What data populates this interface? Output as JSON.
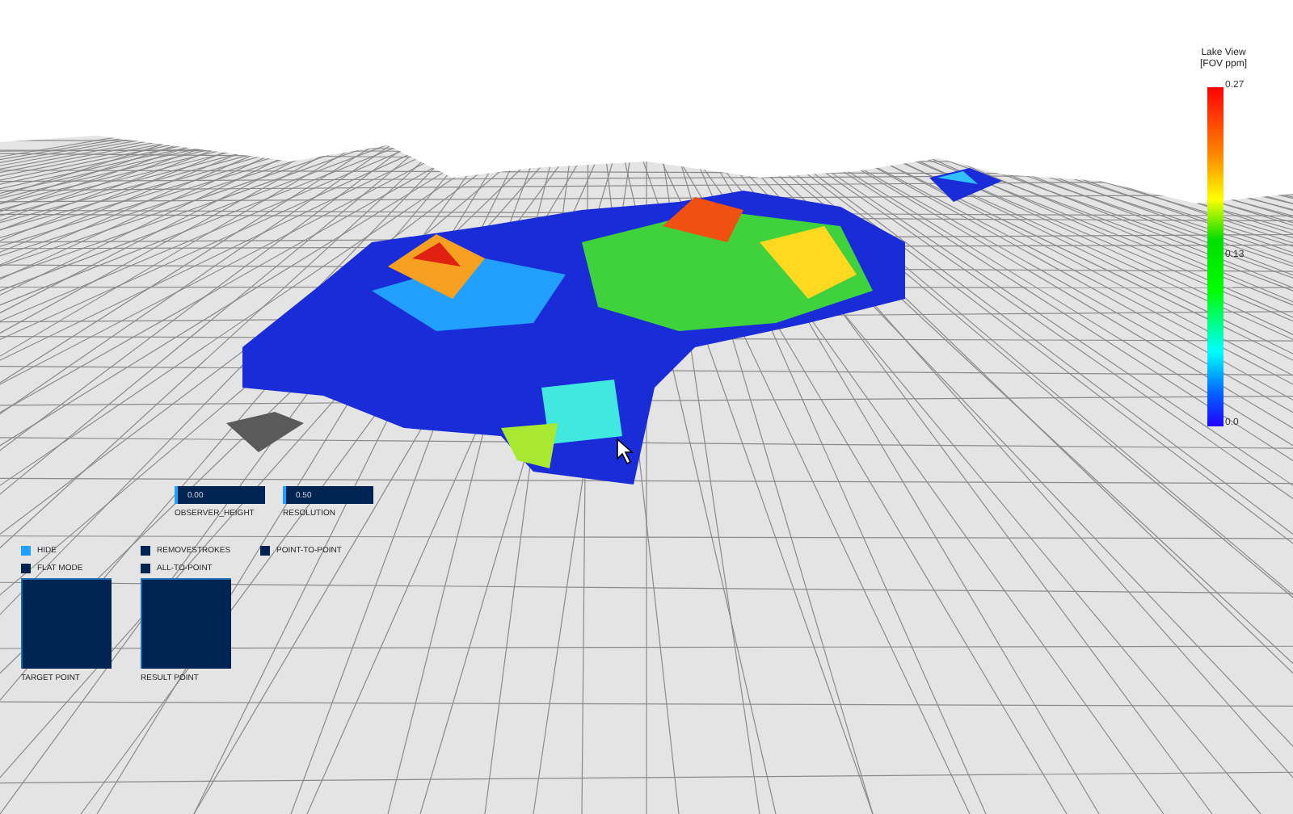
{
  "legend": {
    "title": "Lake View",
    "unit": "[FOV ppm]",
    "max_label": "0.27",
    "mid_label": "0.13",
    "min_label": "0.0"
  },
  "sliders": [
    {
      "label": "OBSERVER_HEIGHT",
      "value": "0.00",
      "level": 0.03
    },
    {
      "label": "RESOLUTION",
      "value": "0.50",
      "level": 0.03
    }
  ],
  "toggles": [
    {
      "label": "HIDE",
      "checked": true
    },
    {
      "label": "REMOVESTROKES",
      "checked": false
    },
    {
      "label": "POINT-TO-POINT",
      "checked": false
    },
    {
      "label": "FLAT MODE",
      "checked": false
    },
    {
      "label": "ALL-TO-POINT",
      "checked": false
    }
  ],
  "pads": [
    {
      "label": "TARGET POINT"
    },
    {
      "label": "RESULT POINT"
    }
  ]
}
